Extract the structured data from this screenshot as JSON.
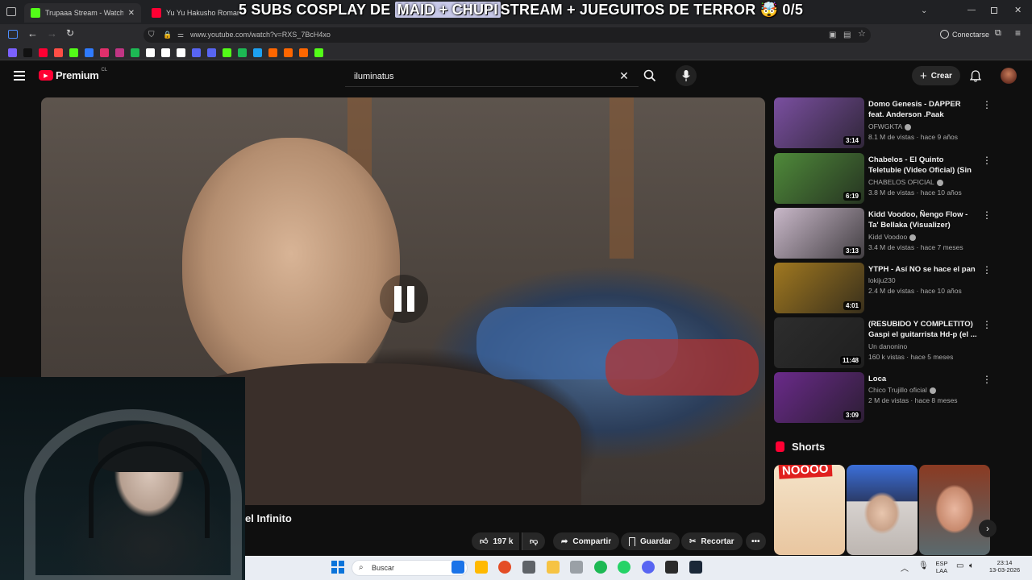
{
  "browser": {
    "tabs": [
      {
        "label": "Trupaaa Stream - Watch Live on",
        "color": "#53fc18"
      },
      {
        "label": "Yu Yu Hakusho Romantic fi",
        "color": "#ff0033"
      }
    ],
    "url": "www.youtube.com/watch?v=RXS_7BcH4xo",
    "connect_label": "Conectarse",
    "bookmark_colors": [
      "#7b61ff",
      "#111111",
      "#ff0033",
      "#ff4e45",
      "#53fc18",
      "#2f7bff",
      "#e1306c",
      "#c13584",
      "#1db954",
      "#ffffff",
      "#ffffff",
      "#ffffff",
      "#5865f2",
      "#5865f2",
      "#53fc18",
      "#1db954",
      "#1da1f2",
      "#ff6600",
      "#ff6600",
      "#ff6600",
      "#53fc18"
    ]
  },
  "stream_overlay": {
    "title_before": "5 SUBS COSPLAY DE",
    "title_highlight": "MAID + CHUPI",
    "title_after": "STREAM + JUEGUITOS DE TERROR 🤯 0/5"
  },
  "youtube": {
    "logo": "Premium",
    "country": "CL",
    "search_value": "iluminatus",
    "create_label": "Crear",
    "video": {
      "title_fragment": "el Infinito",
      "likes": "197 k",
      "share_label": "Compartir",
      "save_label": "Guardar",
      "clip_label": "Recortar"
    },
    "recommendations": [
      {
        "title": "Domo Genesis - DAPPER feat. Anderson .Paak",
        "channel": "OFWGKTA",
        "verified": true,
        "meta": "8.1 M de vistas · hace 9 años",
        "duration": "3:14",
        "thumb": "#7a4fa0"
      },
      {
        "title": "Chabelos - El Quinto Teletubie (Video Oficial) (Sin Censura)",
        "channel": "CHABELOS OFICIAL",
        "verified": true,
        "meta": "3.8 M de vistas · hace 10 años",
        "duration": "6:19",
        "thumb": "#4f8a3a"
      },
      {
        "title": "Kidd Voodoo, Ñengo Flow - Ta' Bellaka (Visualizer)",
        "channel": "Kidd Voodoo",
        "verified": true,
        "meta": "3.4 M de vistas · hace 7 meses",
        "duration": "3:13",
        "thumb": "#c9b8c9"
      },
      {
        "title": "YTPH - Así NO se hace el pan",
        "channel": "lokiju230",
        "verified": false,
        "meta": "2.4 M de vistas · hace 10 años",
        "duration": "4:01",
        "thumb": "#a07820"
      },
      {
        "title": "(RESUBIDO Y COMPLETITO) Gaspi el guitarrista Hd-p (el ...",
        "channel": "Un danonino",
        "verified": false,
        "meta": "160 k vistas · hace 5 meses",
        "duration": "11:48",
        "thumb": "#2d2d2d"
      },
      {
        "title": "Loca",
        "channel": "Chico Trujillo oficial",
        "verified": true,
        "meta": "2 M de vistas · hace 8 meses",
        "duration": "3:09",
        "thumb": "#6a2a8a"
      }
    ],
    "shorts_label": "Shorts",
    "shorts": [
      {
        "caption": "NOOOO",
        "color": "#f2d7b4"
      },
      {
        "caption": "",
        "color": "#3b6fd9"
      },
      {
        "caption": "",
        "color": "#b56a4a"
      }
    ]
  },
  "taskbar": {
    "search_placeholder": "Buscar",
    "lang_line1": "ESP",
    "lang_line2": "LAA",
    "time": "23:14",
    "date": "13-03-2026",
    "app_colors": [
      "#1a73e8",
      "#ffb900",
      "#e44d26",
      "#5f6368",
      "#f6c343",
      "#9aa0a6",
      "#1db954",
      "#25d366",
      "#5865f2",
      "#2b2b2b",
      "#1b2838"
    ]
  }
}
